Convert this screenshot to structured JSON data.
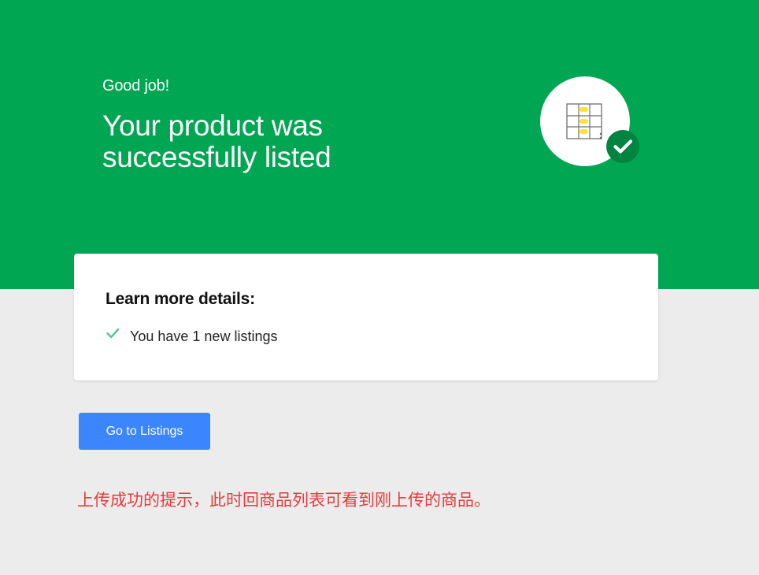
{
  "hero": {
    "eyebrow": "Good job!",
    "headline": "Your product was successfully listed",
    "illustration_icon": "listing-table-icon",
    "badge_icon": "check-circle-icon"
  },
  "details": {
    "title": "Learn more details:",
    "items": [
      {
        "icon": "check-icon",
        "text": "You have 1 new listings"
      }
    ]
  },
  "actions": {
    "go_to_listings": "Go to Listings"
  },
  "annotation": {
    "text": "上传成功的提示，此时回商品列表可看到刚上传的商品。"
  },
  "colors": {
    "hero_background": "#00a651",
    "page_background": "#ececec",
    "primary_button": "#3b86ff",
    "success_badge": "#00843f",
    "success_check": "#52c58a",
    "highlight_yellow": "#ffe433",
    "annotation_red": "#e73b3b"
  }
}
